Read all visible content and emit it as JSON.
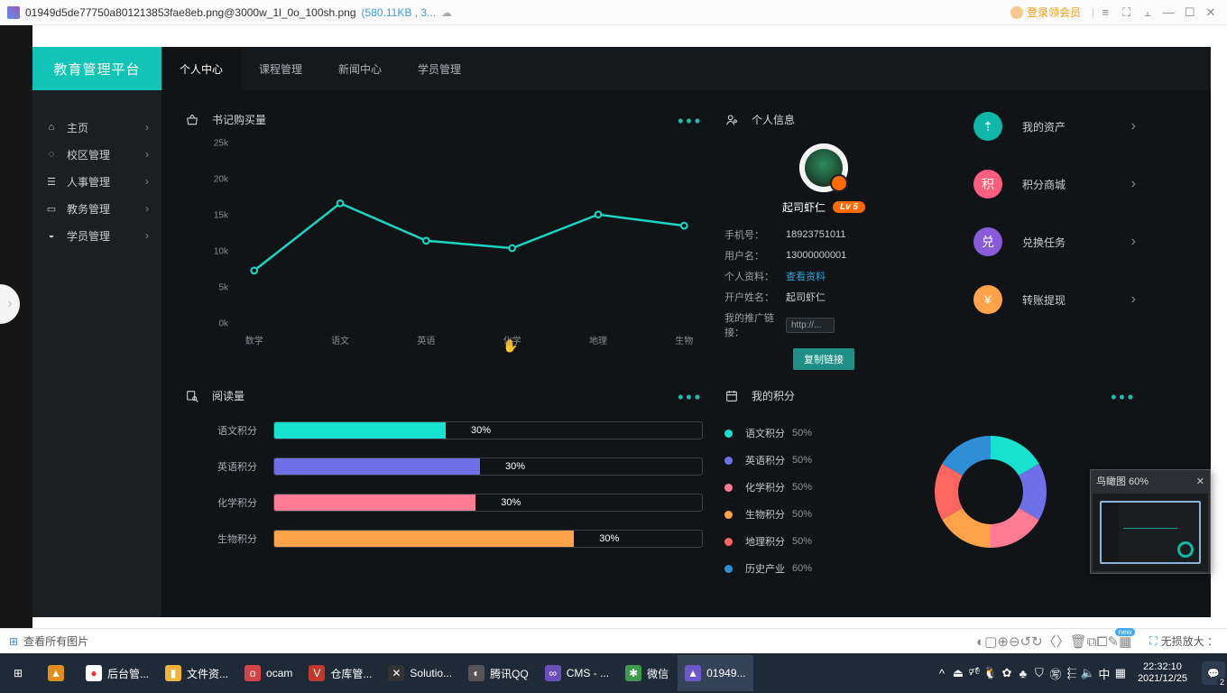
{
  "window": {
    "filename": "01949d5de77750a801213853fae8eb.png@3000w_1l_0o_100sh.png",
    "meta": "(580.11KB , 3...",
    "member": "登录领会员",
    "controls": [
      "≡",
      "⛶",
      "⫠",
      "—",
      "☐",
      "✕"
    ]
  },
  "viewerbar": {
    "all_images": "查看所有图片",
    "tools": [
      "◐",
      "▢",
      "⊕",
      "⊖",
      "↺",
      "↻",
      "〈",
      "〉",
      "🗑",
      "⧉",
      "⧠",
      "✎",
      "▦"
    ],
    "newTag": "new",
    "zoom": "无损放大 ："
  },
  "birdview": {
    "title": "鸟瞰图 60%"
  },
  "dashboard": {
    "brand": "教育管理平台",
    "sideitems": [
      {
        "icon": "⌂",
        "label": "主页"
      },
      {
        "icon": "◌",
        "label": "校区管理"
      },
      {
        "icon": "☰",
        "label": "人事管理"
      },
      {
        "icon": "▭",
        "label": "教务管理"
      },
      {
        "icon": "◒",
        "label": "学员管理"
      }
    ],
    "topnav": [
      "个人中心",
      "课程管理",
      "新闻中心",
      "学员管理"
    ],
    "cards": {
      "chartTitle": "书记购买量",
      "profileTitle": "个人信息",
      "readTitle": "阅读量",
      "pointsTitle": "我的积分"
    },
    "actions": [
      {
        "label": "我的资产",
        "class": "c-teal",
        "glyph": "⇡"
      },
      {
        "label": "积分商城",
        "class": "c-pink",
        "glyph": "积"
      },
      {
        "label": "兑换任务",
        "class": "c-purple",
        "glyph": "兑"
      },
      {
        "label": "转账提现",
        "class": "c-orange",
        "glyph": "¥"
      }
    ],
    "profile": {
      "name": "起司虾仁",
      "level": "Lv 5",
      "rows": [
        {
          "k": "手机号：",
          "v": "18923751011"
        },
        {
          "k": "用户名：",
          "v": "13000000001"
        },
        {
          "k": "个人资料：",
          "v": "查看资料",
          "link": true
        },
        {
          "k": "开户姓名：",
          "v": "起司虾仁"
        },
        {
          "k": "我的推广链接：",
          "v": "http://...",
          "box": true
        }
      ],
      "copy": "复制链接"
    },
    "bars": [
      {
        "label": "语文积分",
        "pct": 30,
        "color": "#16e2cf",
        "fill": 40
      },
      {
        "label": "英语积分",
        "pct": 30,
        "color": "#6f6fe8",
        "fill": 48
      },
      {
        "label": "化学积分",
        "pct": 30,
        "color": "#ff7a93",
        "fill": 47
      },
      {
        "label": "生物积分",
        "pct": 30,
        "color": "#ffa24a",
        "fill": 70
      }
    ],
    "legend": [
      {
        "label": "语文积分",
        "pct": "50%",
        "color": "#16e2cf"
      },
      {
        "label": "英语积分",
        "pct": "50%",
        "color": "#6f6fe8"
      },
      {
        "label": "化学积分",
        "pct": "50%",
        "color": "#ff7a93"
      },
      {
        "label": "生物积分",
        "pct": "50%",
        "color": "#ffa24a"
      },
      {
        "label": "地理积分",
        "pct": "50%",
        "color": "#ff665f"
      },
      {
        "label": "历史产业",
        "pct": "60%",
        "color": "#2f8ed6"
      }
    ]
  },
  "chart_data": {
    "type": "line",
    "title": "书记购买量",
    "categories": [
      "数学",
      "语文",
      "英语",
      "化学",
      "地理",
      "生物"
    ],
    "values": [
      8000,
      17000,
      12000,
      11000,
      15500,
      14000
    ],
    "ylabel": "",
    "xlabel": "",
    "ylim": [
      0,
      25000
    ],
    "yticks": [
      "0k",
      "5k",
      "10k",
      "15k",
      "20k",
      "25k"
    ]
  },
  "taskbar": {
    "items": [
      {
        "icon": "⊞",
        "bg": "#1f2a38"
      },
      {
        "icon": "▲",
        "bg": "#e08f1e",
        "iconColor": "#fff"
      },
      {
        "icon": "●",
        "bg": "#fff",
        "iconColor": "#e33",
        "label": "后台管..."
      },
      {
        "icon": "▮",
        "bg": "#f0b43a",
        "label": "文件资..."
      },
      {
        "icon": "o",
        "bg": "#d64545",
        "label": "ocam"
      },
      {
        "icon": "V",
        "bg": "#c0392b",
        "label": "仓库管..."
      },
      {
        "icon": "✕",
        "bg": "#333",
        "label": "Solutio..."
      },
      {
        "icon": "◐",
        "bg": "#555",
        "label": "腾讯QQ"
      },
      {
        "icon": "∞",
        "bg": "#6b4fbb",
        "label": "CMS - ..."
      },
      {
        "icon": "✱",
        "bg": "#3a9b4b",
        "label": "微信"
      },
      {
        "icon": "▲",
        "bg": "#6a5acd",
        "label": "01949...",
        "active": true
      }
    ],
    "tray": [
      "^",
      "⏏",
      "🕫",
      "🐧",
      "✿",
      "♣",
      "⛉",
      "㊢",
      "⬱",
      "🔈",
      "中",
      "▦"
    ],
    "time": "22:32:10",
    "date": "2021/12/25",
    "notif": "2"
  }
}
